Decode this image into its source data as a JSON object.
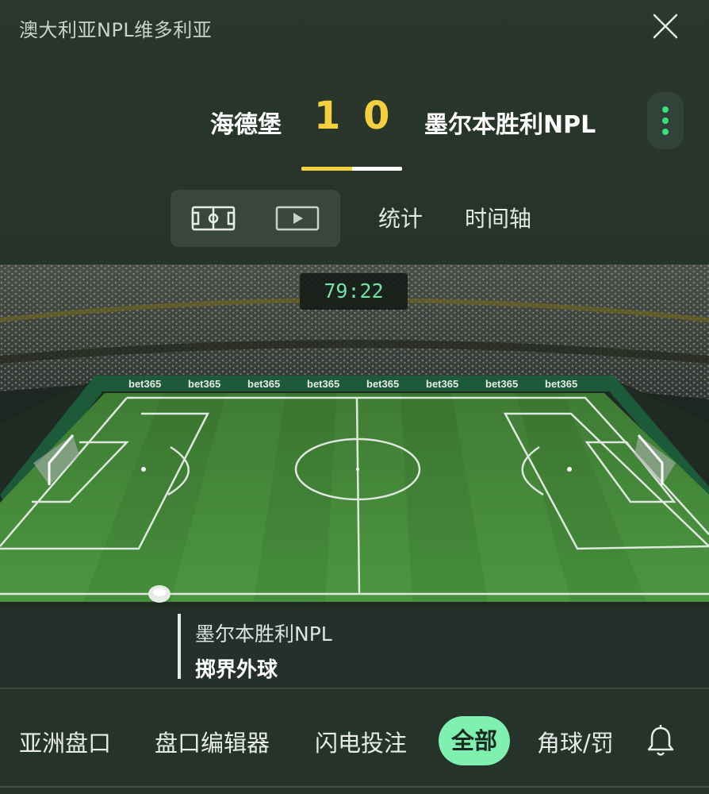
{
  "header": {
    "league": "澳大利亚NPL维多利亚",
    "home_team": "海德堡",
    "away_team": "墨尔本胜利NPL",
    "home_score": "1",
    "away_score": "0",
    "progress_fraction": 0.5
  },
  "tabs": {
    "stats": "统计",
    "timeline": "时间轴"
  },
  "pitch": {
    "clock": "79:22",
    "sponsor": "bet365",
    "event_team": "墨尔本胜利NPL",
    "event_name": "掷界外球"
  },
  "bottom_nav": {
    "items": [
      "亚洲盘口",
      "盘口编辑器",
      "闪电投注",
      "全部",
      "角球/罚"
    ],
    "active": "全部"
  },
  "icons": {
    "close": "close-icon",
    "more": "more-vertical-icon",
    "pitch_view": "pitch-icon",
    "video_view": "play-icon",
    "bell": "bell-icon",
    "ball": "ball-icon"
  },
  "colors": {
    "score": "#f4d03f",
    "accent": "#3be07a",
    "active_pill": "#7ff0b0",
    "clock": "#6fe3a8",
    "pitch_green": "#3f8a3a"
  }
}
